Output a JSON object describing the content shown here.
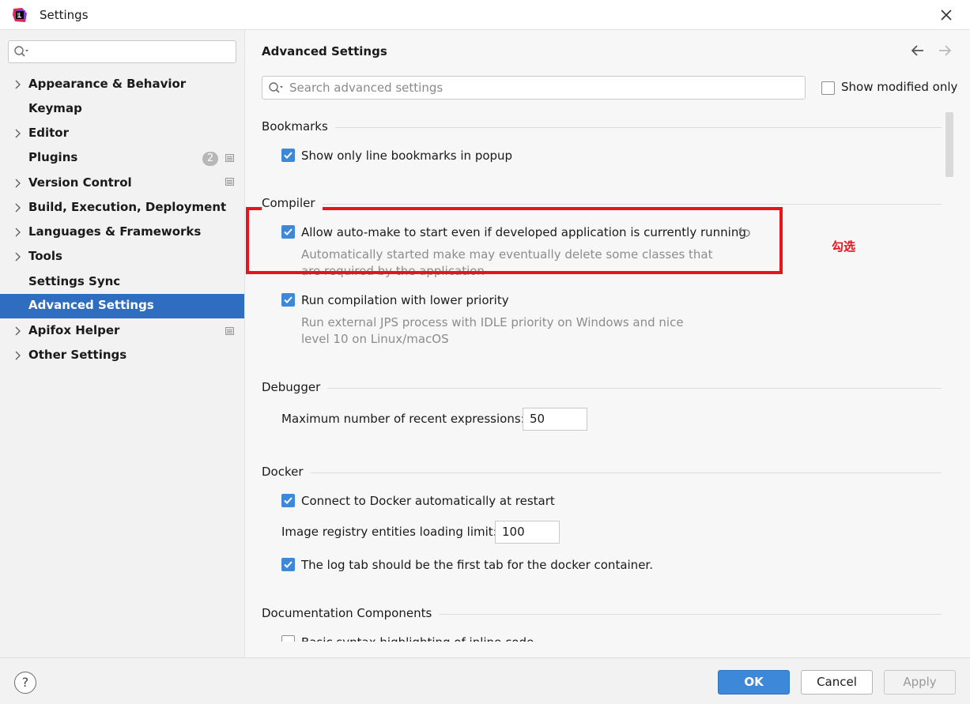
{
  "window": {
    "title": "Settings",
    "logo_icon": "intellij-logo-icon",
    "close_icon": "close-icon"
  },
  "sidebar": {
    "search": {
      "placeholder": "",
      "icon": "search-icon"
    },
    "items": [
      {
        "label": "Appearance & Behavior",
        "expandable": true
      },
      {
        "label": "Keymap",
        "expandable": false
      },
      {
        "label": "Editor",
        "expandable": true
      },
      {
        "label": "Plugins",
        "expandable": false,
        "badge": "2",
        "project_icon": true
      },
      {
        "label": "Version Control",
        "expandable": true,
        "project_icon": true
      },
      {
        "label": "Build, Execution, Deployment",
        "expandable": true
      },
      {
        "label": "Languages & Frameworks",
        "expandable": true
      },
      {
        "label": "Tools",
        "expandable": true
      },
      {
        "label": "Settings Sync",
        "expandable": false
      },
      {
        "label": "Advanced Settings",
        "expandable": false,
        "selected": true
      },
      {
        "label": "Apifox Helper",
        "expandable": true,
        "project_icon": true
      },
      {
        "label": "Other Settings",
        "expandable": true
      }
    ]
  },
  "main": {
    "title": "Advanced Settings",
    "search": {
      "placeholder": "Search advanced settings",
      "value": ""
    },
    "show_modified_only": {
      "label": "Show modified only",
      "checked": false
    },
    "sections": {
      "bookmarks": {
        "title": "Bookmarks",
        "options": [
          {
            "label": "Show only line bookmarks in popup",
            "checked": true
          }
        ]
      },
      "compiler": {
        "title": "Compiler",
        "auto_make": {
          "label": "Allow auto-make to start even if developed application is currently running",
          "checked": true,
          "desc_line1": "Automatically started make may eventually delete some classes that",
          "desc_line2": "are required by the application"
        },
        "low_priority": {
          "label": "Run compilation with lower priority",
          "checked": true,
          "desc_line1": "Run external JPS process with IDLE priority on Windows and nice",
          "desc_line2": "level 10 on Linux/macOS"
        }
      },
      "debugger": {
        "title": "Debugger",
        "recent_expressions": {
          "label": "Maximum number of recent expressions:",
          "value": "50"
        }
      },
      "docker": {
        "title": "Docker",
        "connect": {
          "label": "Connect to Docker automatically at restart",
          "checked": true
        },
        "registry_limit": {
          "label": "Image registry entities loading limit:",
          "value": "100"
        },
        "log_tab": {
          "label": "The log tab should be the first tab for the docker container.",
          "checked": true
        }
      },
      "documentation": {
        "title": "Documentation Components",
        "syntax": {
          "label": "Basic syntax highlighting of inline code",
          "checked": false
        }
      }
    }
  },
  "annotation": {
    "text": "勾选",
    "color": "#e8141a"
  },
  "footer": {
    "help": "?",
    "ok": "OK",
    "cancel": "Cancel",
    "apply": "Apply"
  },
  "colors": {
    "accent": "#3d88d8",
    "selection": "#2e6dbf",
    "highlight": "#e8141a"
  }
}
